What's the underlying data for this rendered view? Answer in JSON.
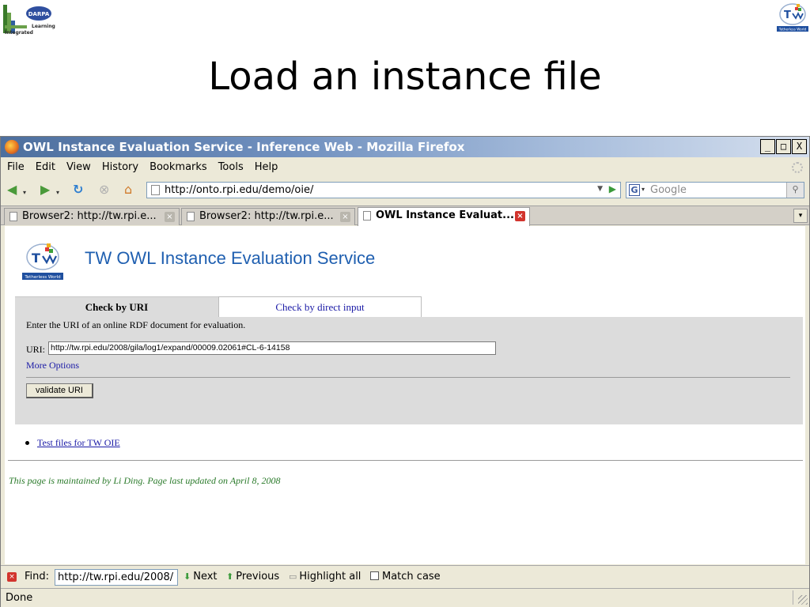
{
  "slide": {
    "title": "Load an instance file",
    "left_logo": {
      "badge": "DARPA",
      "text_top": "Learning",
      "text_bottom": "Integrated"
    },
    "right_logo": {
      "caption": "Tetherless World"
    }
  },
  "browser": {
    "window_title": "OWL Instance Evaluation Service - Inference Web - Mozilla Firefox",
    "window_buttons": [
      "_",
      "□",
      "X"
    ],
    "menu": [
      "File",
      "Edit",
      "View",
      "History",
      "Bookmarks",
      "Tools",
      "Help"
    ],
    "url": "http://onto.rpi.edu/demo/oie/",
    "search_placeholder": "Google",
    "tabs": [
      {
        "label": "Browser2: http://tw.rpi.e...",
        "active": false
      },
      {
        "label": "Browser2: http://tw.rpi.e...",
        "active": false
      },
      {
        "label": "OWL Instance Evaluat...",
        "active": true
      }
    ],
    "find": {
      "label": "Find:",
      "value": "http://tw.rpi.edu/2008/",
      "next": "Next",
      "previous": "Previous",
      "highlight": "Highlight all",
      "match_case": "Match case"
    },
    "status": "Done"
  },
  "page": {
    "logo_caption": "Tetherless World",
    "heading": "TW OWL Instance Evaluation Service",
    "tabs": [
      "Check by URI",
      "Check by direct input"
    ],
    "instructions": "Enter the URI of an online RDF document for evaluation.",
    "uri_label": "URI:",
    "uri_value": "http://tw.rpi.edu/2008/gila/log1/expand/00009.02061#CL-6-14158",
    "more_options": "More Options",
    "validate_button": "validate URI",
    "links": [
      "Test files for TW OIE"
    ],
    "footer": "This page is maintained by Li Ding. Page last updated on  April 8, 2008"
  },
  "colors": {
    "heading": "#1f5fb0",
    "link": "#1a1aa6",
    "footer": "#2a7a2a",
    "panel": "#dcdcdc",
    "titlebar": "#4d6f9e"
  }
}
